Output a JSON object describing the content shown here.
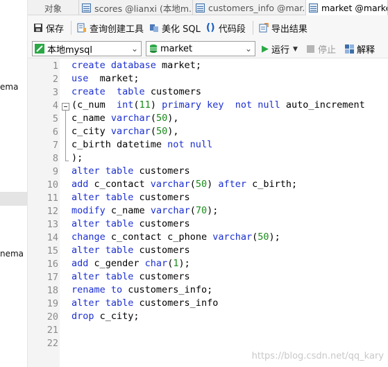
{
  "left_panel": {
    "items": [
      "ema",
      "nema"
    ]
  },
  "tabs": [
    {
      "label": "对象",
      "icon": "none"
    },
    {
      "label": "scores @lianxi (本地m...",
      "icon": "table-icon"
    },
    {
      "label": "customers_info @mar...",
      "icon": "table-icon"
    },
    {
      "label": "market @market",
      "icon": "query-icon"
    }
  ],
  "toolbar": {
    "save_label": "保存",
    "query_builder_label": "查询创建工具",
    "beautify_label": "美化 SQL",
    "snippet_label": "代码段",
    "export_label": "导出结果"
  },
  "runbar": {
    "connection": "本地mysql",
    "database": "market",
    "run_label": "运行",
    "stop_label": "停止",
    "explain_label": "解释"
  },
  "editor": {
    "lines": [
      [
        [
          "kw",
          "create database"
        ],
        [
          "p",
          " market;"
        ]
      ],
      [
        [
          "kw",
          "use"
        ],
        [
          "p",
          "  market;"
        ]
      ],
      [
        [
          "kw",
          "create"
        ],
        [
          "p",
          "  "
        ],
        [
          "kw",
          "table"
        ],
        [
          "p",
          " customers"
        ]
      ],
      [
        [
          "p",
          "(c_num  "
        ],
        [
          "kw",
          "int"
        ],
        [
          "p",
          "("
        ],
        [
          "num",
          "11"
        ],
        [
          "p",
          ") "
        ],
        [
          "kw",
          "primary key"
        ],
        [
          "p",
          "  "
        ],
        [
          "kw",
          "not null"
        ],
        [
          "p",
          " auto_increment"
        ]
      ],
      [
        [
          "p",
          "c_name "
        ],
        [
          "kw",
          "varchar"
        ],
        [
          "p",
          "("
        ],
        [
          "num",
          "50"
        ],
        [
          "p",
          "),"
        ]
      ],
      [
        [
          "p",
          "c_city "
        ],
        [
          "kw",
          "varchar"
        ],
        [
          "p",
          "("
        ],
        [
          "num",
          "50"
        ],
        [
          "p",
          "),"
        ]
      ],
      [
        [
          "p",
          "c_birth datetime "
        ],
        [
          "kw",
          "not null"
        ]
      ],
      [
        [
          "p",
          ");"
        ]
      ],
      [
        [
          "kw",
          "alter table"
        ],
        [
          "p",
          " customers"
        ]
      ],
      [
        [
          "kw",
          "add"
        ],
        [
          "p",
          " c_contact "
        ],
        [
          "kw",
          "varchar"
        ],
        [
          "p",
          "("
        ],
        [
          "num",
          "50"
        ],
        [
          "p",
          ") "
        ],
        [
          "kw",
          "after"
        ],
        [
          "p",
          " c_birth;"
        ]
      ],
      [
        [
          "kw",
          "alter table"
        ],
        [
          "p",
          " customers"
        ]
      ],
      [
        [
          "kw",
          "modify"
        ],
        [
          "p",
          " c_name "
        ],
        [
          "kw",
          "varchar"
        ],
        [
          "p",
          "("
        ],
        [
          "num",
          "70"
        ],
        [
          "p",
          ");"
        ]
      ],
      [
        [
          "kw",
          "alter table"
        ],
        [
          "p",
          " customers"
        ]
      ],
      [
        [
          "kw",
          "change"
        ],
        [
          "p",
          " c_contact c_phone "
        ],
        [
          "kw",
          "varchar"
        ],
        [
          "p",
          "("
        ],
        [
          "num",
          "50"
        ],
        [
          "p",
          ");"
        ]
      ],
      [
        [
          "kw",
          "alter table"
        ],
        [
          "p",
          " customers"
        ]
      ],
      [
        [
          "kw",
          "add"
        ],
        [
          "p",
          " c_gender "
        ],
        [
          "kw",
          "char"
        ],
        [
          "p",
          "("
        ],
        [
          "num",
          "1"
        ],
        [
          "p",
          ");"
        ]
      ],
      [
        [
          "kw",
          "alter table"
        ],
        [
          "p",
          " customers"
        ]
      ],
      [
        [
          "kw",
          "rename to"
        ],
        [
          "p",
          " customers_info;"
        ]
      ],
      [
        [
          "kw",
          "alter table"
        ],
        [
          "p",
          " customers_info"
        ]
      ],
      [
        [
          "kw",
          "drop"
        ],
        [
          "p",
          " c_city;"
        ]
      ],
      [],
      []
    ]
  },
  "watermark": "https://blog.csdn.net/qq_kary",
  "colors": {
    "keyword": "#1b2fd0",
    "number": "#1a8a1a",
    "gutter_bg": "#f4f4f4",
    "line_number": "#8a8a8a"
  }
}
